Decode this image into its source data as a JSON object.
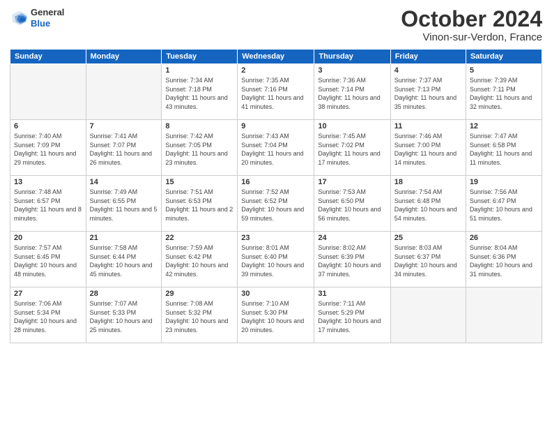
{
  "header": {
    "logo": {
      "general": "General",
      "blue": "Blue"
    },
    "title": "October 2024",
    "location": "Vinon-sur-Verdon, France"
  },
  "days_of_week": [
    "Sunday",
    "Monday",
    "Tuesday",
    "Wednesday",
    "Thursday",
    "Friday",
    "Saturday"
  ],
  "weeks": [
    [
      {
        "day": "",
        "sunrise": "",
        "sunset": "",
        "daylight": ""
      },
      {
        "day": "",
        "sunrise": "",
        "sunset": "",
        "daylight": ""
      },
      {
        "day": "1",
        "sunrise": "Sunrise: 7:34 AM",
        "sunset": "Sunset: 7:18 PM",
        "daylight": "Daylight: 11 hours and 43 minutes."
      },
      {
        "day": "2",
        "sunrise": "Sunrise: 7:35 AM",
        "sunset": "Sunset: 7:16 PM",
        "daylight": "Daylight: 11 hours and 41 minutes."
      },
      {
        "day": "3",
        "sunrise": "Sunrise: 7:36 AM",
        "sunset": "Sunset: 7:14 PM",
        "daylight": "Daylight: 11 hours and 38 minutes."
      },
      {
        "day": "4",
        "sunrise": "Sunrise: 7:37 AM",
        "sunset": "Sunset: 7:13 PM",
        "daylight": "Daylight: 11 hours and 35 minutes."
      },
      {
        "day": "5",
        "sunrise": "Sunrise: 7:39 AM",
        "sunset": "Sunset: 7:11 PM",
        "daylight": "Daylight: 11 hours and 32 minutes."
      }
    ],
    [
      {
        "day": "6",
        "sunrise": "Sunrise: 7:40 AM",
        "sunset": "Sunset: 7:09 PM",
        "daylight": "Daylight: 11 hours and 29 minutes."
      },
      {
        "day": "7",
        "sunrise": "Sunrise: 7:41 AM",
        "sunset": "Sunset: 7:07 PM",
        "daylight": "Daylight: 11 hours and 26 minutes."
      },
      {
        "day": "8",
        "sunrise": "Sunrise: 7:42 AM",
        "sunset": "Sunset: 7:05 PM",
        "daylight": "Daylight: 11 hours and 23 minutes."
      },
      {
        "day": "9",
        "sunrise": "Sunrise: 7:43 AM",
        "sunset": "Sunset: 7:04 PM",
        "daylight": "Daylight: 11 hours and 20 minutes."
      },
      {
        "day": "10",
        "sunrise": "Sunrise: 7:45 AM",
        "sunset": "Sunset: 7:02 PM",
        "daylight": "Daylight: 11 hours and 17 minutes."
      },
      {
        "day": "11",
        "sunrise": "Sunrise: 7:46 AM",
        "sunset": "Sunset: 7:00 PM",
        "daylight": "Daylight: 11 hours and 14 minutes."
      },
      {
        "day": "12",
        "sunrise": "Sunrise: 7:47 AM",
        "sunset": "Sunset: 6:58 PM",
        "daylight": "Daylight: 11 hours and 11 minutes."
      }
    ],
    [
      {
        "day": "13",
        "sunrise": "Sunrise: 7:48 AM",
        "sunset": "Sunset: 6:57 PM",
        "daylight": "Daylight: 11 hours and 8 minutes."
      },
      {
        "day": "14",
        "sunrise": "Sunrise: 7:49 AM",
        "sunset": "Sunset: 6:55 PM",
        "daylight": "Daylight: 11 hours and 5 minutes."
      },
      {
        "day": "15",
        "sunrise": "Sunrise: 7:51 AM",
        "sunset": "Sunset: 6:53 PM",
        "daylight": "Daylight: 11 hours and 2 minutes."
      },
      {
        "day": "16",
        "sunrise": "Sunrise: 7:52 AM",
        "sunset": "Sunset: 6:52 PM",
        "daylight": "Daylight: 10 hours and 59 minutes."
      },
      {
        "day": "17",
        "sunrise": "Sunrise: 7:53 AM",
        "sunset": "Sunset: 6:50 PM",
        "daylight": "Daylight: 10 hours and 56 minutes."
      },
      {
        "day": "18",
        "sunrise": "Sunrise: 7:54 AM",
        "sunset": "Sunset: 6:48 PM",
        "daylight": "Daylight: 10 hours and 54 minutes."
      },
      {
        "day": "19",
        "sunrise": "Sunrise: 7:56 AM",
        "sunset": "Sunset: 6:47 PM",
        "daylight": "Daylight: 10 hours and 51 minutes."
      }
    ],
    [
      {
        "day": "20",
        "sunrise": "Sunrise: 7:57 AM",
        "sunset": "Sunset: 6:45 PM",
        "daylight": "Daylight: 10 hours and 48 minutes."
      },
      {
        "day": "21",
        "sunrise": "Sunrise: 7:58 AM",
        "sunset": "Sunset: 6:44 PM",
        "daylight": "Daylight: 10 hours and 45 minutes."
      },
      {
        "day": "22",
        "sunrise": "Sunrise: 7:59 AM",
        "sunset": "Sunset: 6:42 PM",
        "daylight": "Daylight: 10 hours and 42 minutes."
      },
      {
        "day": "23",
        "sunrise": "Sunrise: 8:01 AM",
        "sunset": "Sunset: 6:40 PM",
        "daylight": "Daylight: 10 hours and 39 minutes."
      },
      {
        "day": "24",
        "sunrise": "Sunrise: 8:02 AM",
        "sunset": "Sunset: 6:39 PM",
        "daylight": "Daylight: 10 hours and 37 minutes."
      },
      {
        "day": "25",
        "sunrise": "Sunrise: 8:03 AM",
        "sunset": "Sunset: 6:37 PM",
        "daylight": "Daylight: 10 hours and 34 minutes."
      },
      {
        "day": "26",
        "sunrise": "Sunrise: 8:04 AM",
        "sunset": "Sunset: 6:36 PM",
        "daylight": "Daylight: 10 hours and 31 minutes."
      }
    ],
    [
      {
        "day": "27",
        "sunrise": "Sunrise: 7:06 AM",
        "sunset": "Sunset: 5:34 PM",
        "daylight": "Daylight: 10 hours and 28 minutes."
      },
      {
        "day": "28",
        "sunrise": "Sunrise: 7:07 AM",
        "sunset": "Sunset: 5:33 PM",
        "daylight": "Daylight: 10 hours and 25 minutes."
      },
      {
        "day": "29",
        "sunrise": "Sunrise: 7:08 AM",
        "sunset": "Sunset: 5:32 PM",
        "daylight": "Daylight: 10 hours and 23 minutes."
      },
      {
        "day": "30",
        "sunrise": "Sunrise: 7:10 AM",
        "sunset": "Sunset: 5:30 PM",
        "daylight": "Daylight: 10 hours and 20 minutes."
      },
      {
        "day": "31",
        "sunrise": "Sunrise: 7:11 AM",
        "sunset": "Sunset: 5:29 PM",
        "daylight": "Daylight: 10 hours and 17 minutes."
      },
      {
        "day": "",
        "sunrise": "",
        "sunset": "",
        "daylight": ""
      },
      {
        "day": "",
        "sunrise": "",
        "sunset": "",
        "daylight": ""
      }
    ]
  ]
}
